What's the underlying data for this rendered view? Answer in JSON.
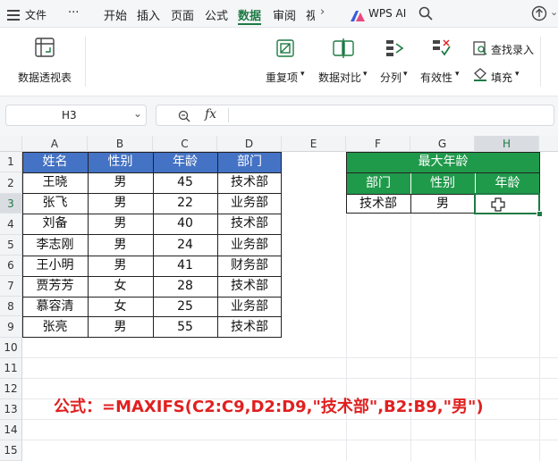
{
  "menubar": {
    "file_label": "文件",
    "more_label": "···",
    "tabs": [
      "开始",
      "插入",
      "页面",
      "公式",
      "数据",
      "审阅",
      "视"
    ],
    "active_tab": "数据",
    "wps_ai_label": "WPS AI"
  },
  "ribbon": {
    "pivot_label": "数据透视表",
    "duplicates_label": "重复项",
    "compare_label": "数据对比",
    "split_label": "分列",
    "validity_label": "有效性",
    "find_entry_label": "查找录入",
    "fill_label": "填充"
  },
  "formula_bar": {
    "name_box": "H3",
    "fx_label": "fx",
    "formula_value": ""
  },
  "sheet": {
    "columns": [
      "A",
      "B",
      "C",
      "D",
      "E",
      "F",
      "G",
      "H"
    ],
    "rows": [
      "1",
      "2",
      "3",
      "4",
      "5",
      "6",
      "7",
      "8",
      "9",
      "10",
      "11",
      "12",
      "13",
      "14",
      "15"
    ],
    "table_headers": [
      "姓名",
      "性别",
      "年龄",
      "部门"
    ],
    "table_rows": [
      [
        "王晓",
        "男",
        "45",
        "技术部"
      ],
      [
        "张飞",
        "男",
        "22",
        "业务部"
      ],
      [
        "刘备",
        "男",
        "40",
        "技术部"
      ],
      [
        "李志刚",
        "男",
        "24",
        "业务部"
      ],
      [
        "王小明",
        "男",
        "41",
        "财务部"
      ],
      [
        "贾芳芳",
        "女",
        "28",
        "技术部"
      ],
      [
        "慕容清",
        "女",
        "25",
        "业务部"
      ],
      [
        "张亮",
        "男",
        "55",
        "技术部"
      ]
    ],
    "right_title": "最大年龄",
    "right_headers": [
      "部门",
      "性别",
      "年龄"
    ],
    "right_values": [
      "技术部",
      "男",
      ""
    ],
    "header_color": "#4472c4",
    "right_header_color": "#1f9a4b",
    "selection_color": "#1f7a44"
  },
  "annotation": {
    "formula_text": "公式：=MAXIFS(C2:C9,D2:D9,\"技术部\",B2:B9,\"男\")"
  }
}
